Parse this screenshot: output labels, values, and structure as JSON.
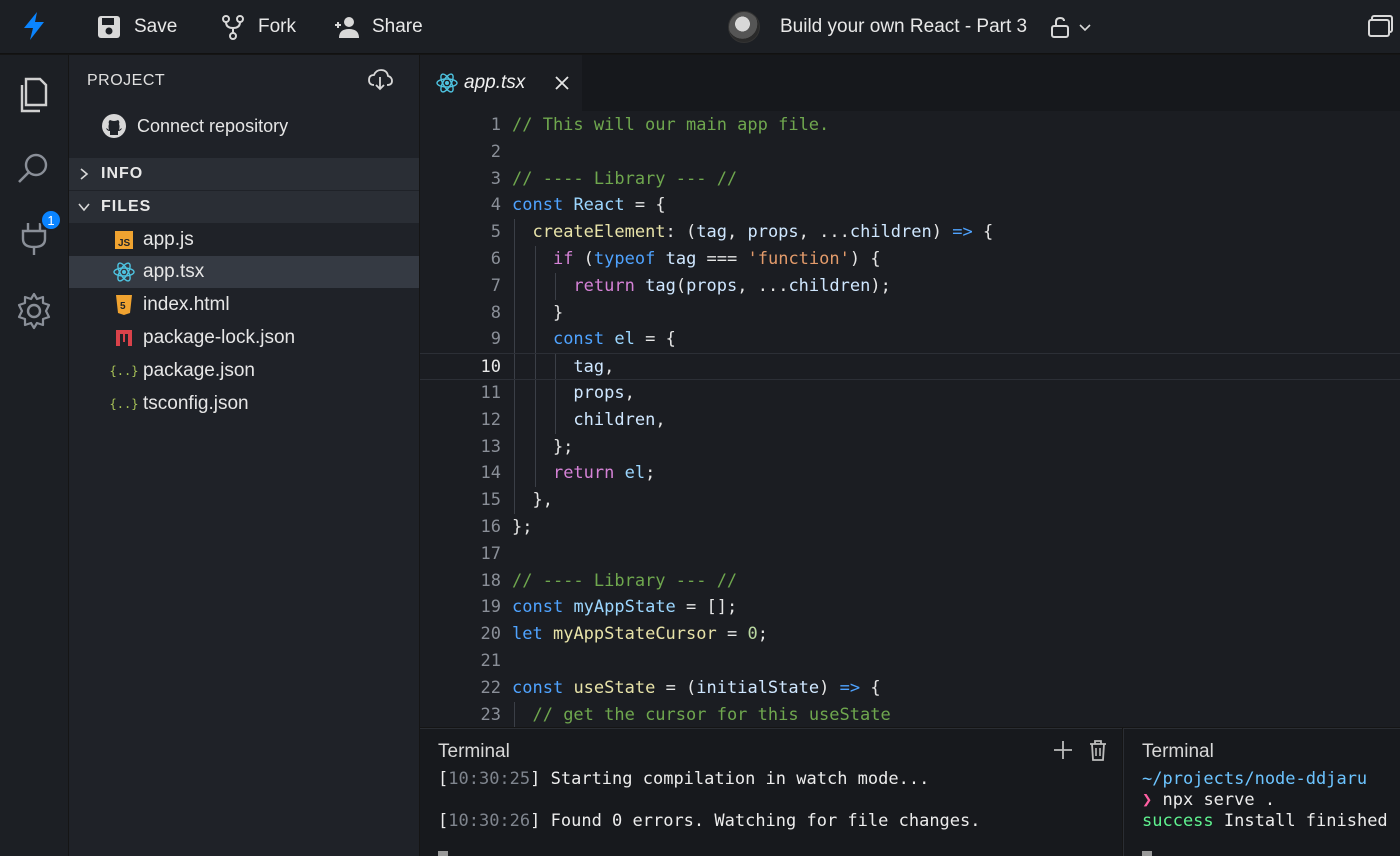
{
  "topbar": {
    "save": "Save",
    "fork": "Fork",
    "share": "Share",
    "title": "Build your own React - Part 3"
  },
  "activity": {
    "badge": "1"
  },
  "sidebar": {
    "header": "PROJECT",
    "connect": "Connect repository",
    "sections": {
      "info": "INFO",
      "files": "FILES"
    },
    "files": [
      {
        "name": "app.js",
        "icon": "js-file-icon"
      },
      {
        "name": "app.tsx",
        "icon": "react-file-icon"
      },
      {
        "name": "index.html",
        "icon": "html-file-icon"
      },
      {
        "name": "package-lock.json",
        "icon": "npm-file-icon"
      },
      {
        "name": "package.json",
        "icon": "json-file-icon"
      },
      {
        "name": "tsconfig.json",
        "icon": "json-file-icon"
      }
    ]
  },
  "editor": {
    "tab": "app.tsx",
    "lines": [
      {
        "n": "1",
        "t": "// This will our main app file."
      },
      {
        "n": "2",
        "t": ""
      },
      {
        "n": "3",
        "t": "// ---- Library --- //"
      },
      {
        "n": "4",
        "t": "const React = {"
      },
      {
        "n": "5",
        "t": "  createElement: (tag, props, ...children) => {"
      },
      {
        "n": "6",
        "t": "    if (typeof tag === 'function') {"
      },
      {
        "n": "7",
        "t": "      return tag(props, ...children);"
      },
      {
        "n": "8",
        "t": "    }"
      },
      {
        "n": "9",
        "t": "    const el = {"
      },
      {
        "n": "10",
        "t": "      tag,"
      },
      {
        "n": "11",
        "t": "      props,"
      },
      {
        "n": "12",
        "t": "      children,"
      },
      {
        "n": "13",
        "t": "    };"
      },
      {
        "n": "14",
        "t": "    return el;"
      },
      {
        "n": "15",
        "t": "  },"
      },
      {
        "n": "16",
        "t": "};"
      },
      {
        "n": "17",
        "t": ""
      },
      {
        "n": "18",
        "t": "// ---- Library --- //"
      },
      {
        "n": "19",
        "t": "const myAppState = [];"
      },
      {
        "n": "20",
        "t": "let myAppStateCursor = 0;"
      },
      {
        "n": "21",
        "t": ""
      },
      {
        "n": "22",
        "t": "const useState = (initialState) => {"
      },
      {
        "n": "23",
        "t": "  // get the cursor for this useState"
      }
    ]
  },
  "terminal1": {
    "title": "Terminal",
    "line1_ts": "10:30:25",
    "line1_msg": "Starting compilation in watch mode...",
    "line2_ts": "10:30:26",
    "line2_msg": "Found 0 errors. Watching for file changes."
  },
  "terminal2": {
    "title": "Terminal",
    "path": "~/projects/node-ddjaru",
    "prompt": "❯",
    "command": "npx serve .",
    "status": "success",
    "status_msg": "Install finished"
  }
}
